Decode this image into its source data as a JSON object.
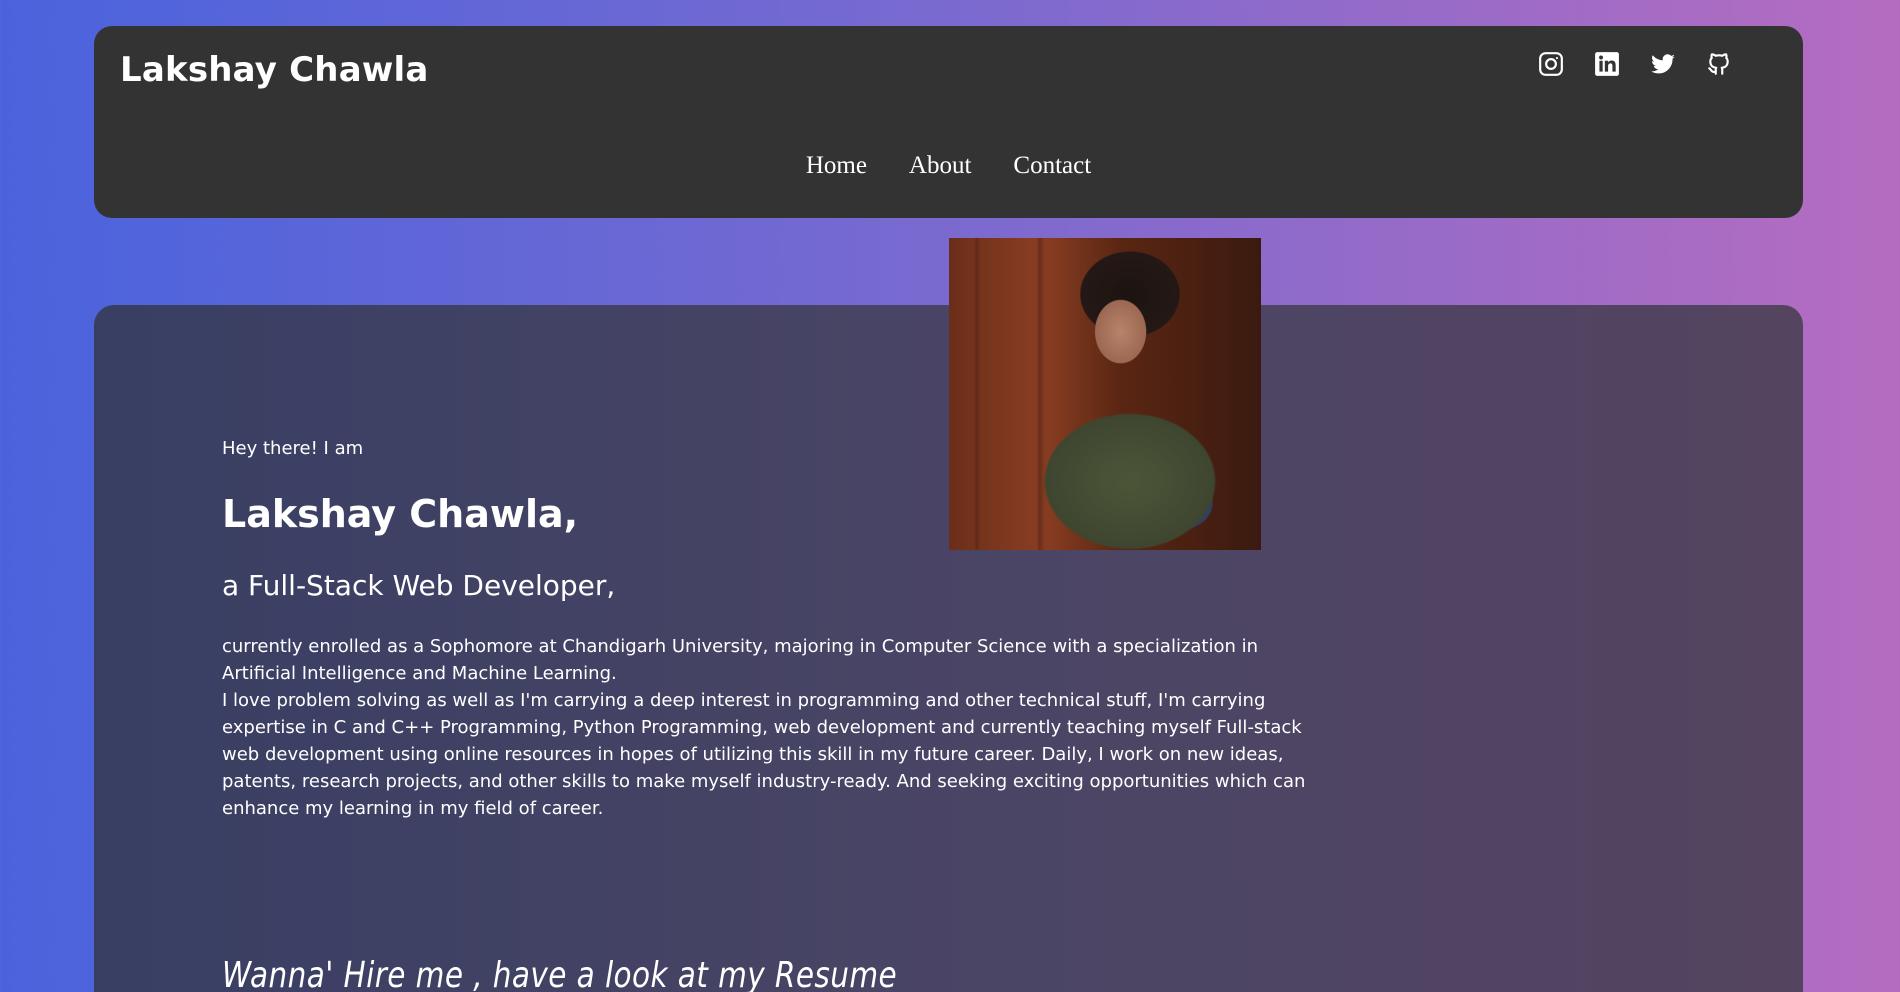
{
  "header": {
    "brand": "Lakshay Chawla",
    "socials": [
      {
        "icon": "instagram-icon"
      },
      {
        "icon": "linkedin-icon"
      },
      {
        "icon": "twitter-icon"
      },
      {
        "icon": "github-icon"
      }
    ],
    "nav": {
      "home": "Home",
      "about": "About",
      "contact": "Contact"
    }
  },
  "intro": {
    "greeting": "Hey there! I am",
    "name": "Lakshay Chawla,",
    "role": "a Full-Stack Web Developer,",
    "bio_paragraph_1": "currently enrolled as a Sophomore at Chandigarh University, majoring in Computer Science with a specialization in Artificial Intelligence and Machine Learning.",
    "bio_paragraph_2": "I love problem solving as well as I'm carrying a deep interest in programming and other technical stuff, I'm carrying expertise in C and C++ Programming, Python Programming, web development and currently teaching myself Full-stack web development using online resources in hopes of utilizing this skill in my future career. Daily, I work on new ideas, patents, research projects, and other skills to make myself industry-ready. And seeking exciting opportunities which can enhance my learning in my field of career.",
    "resume_cta": "Wanna' Hire me , have a look at my Resume"
  },
  "colors": {
    "header_bg": "#333333",
    "text": "#ffffff",
    "gradient_start": "#4a63dd",
    "gradient_end": "#b56cc0"
  }
}
